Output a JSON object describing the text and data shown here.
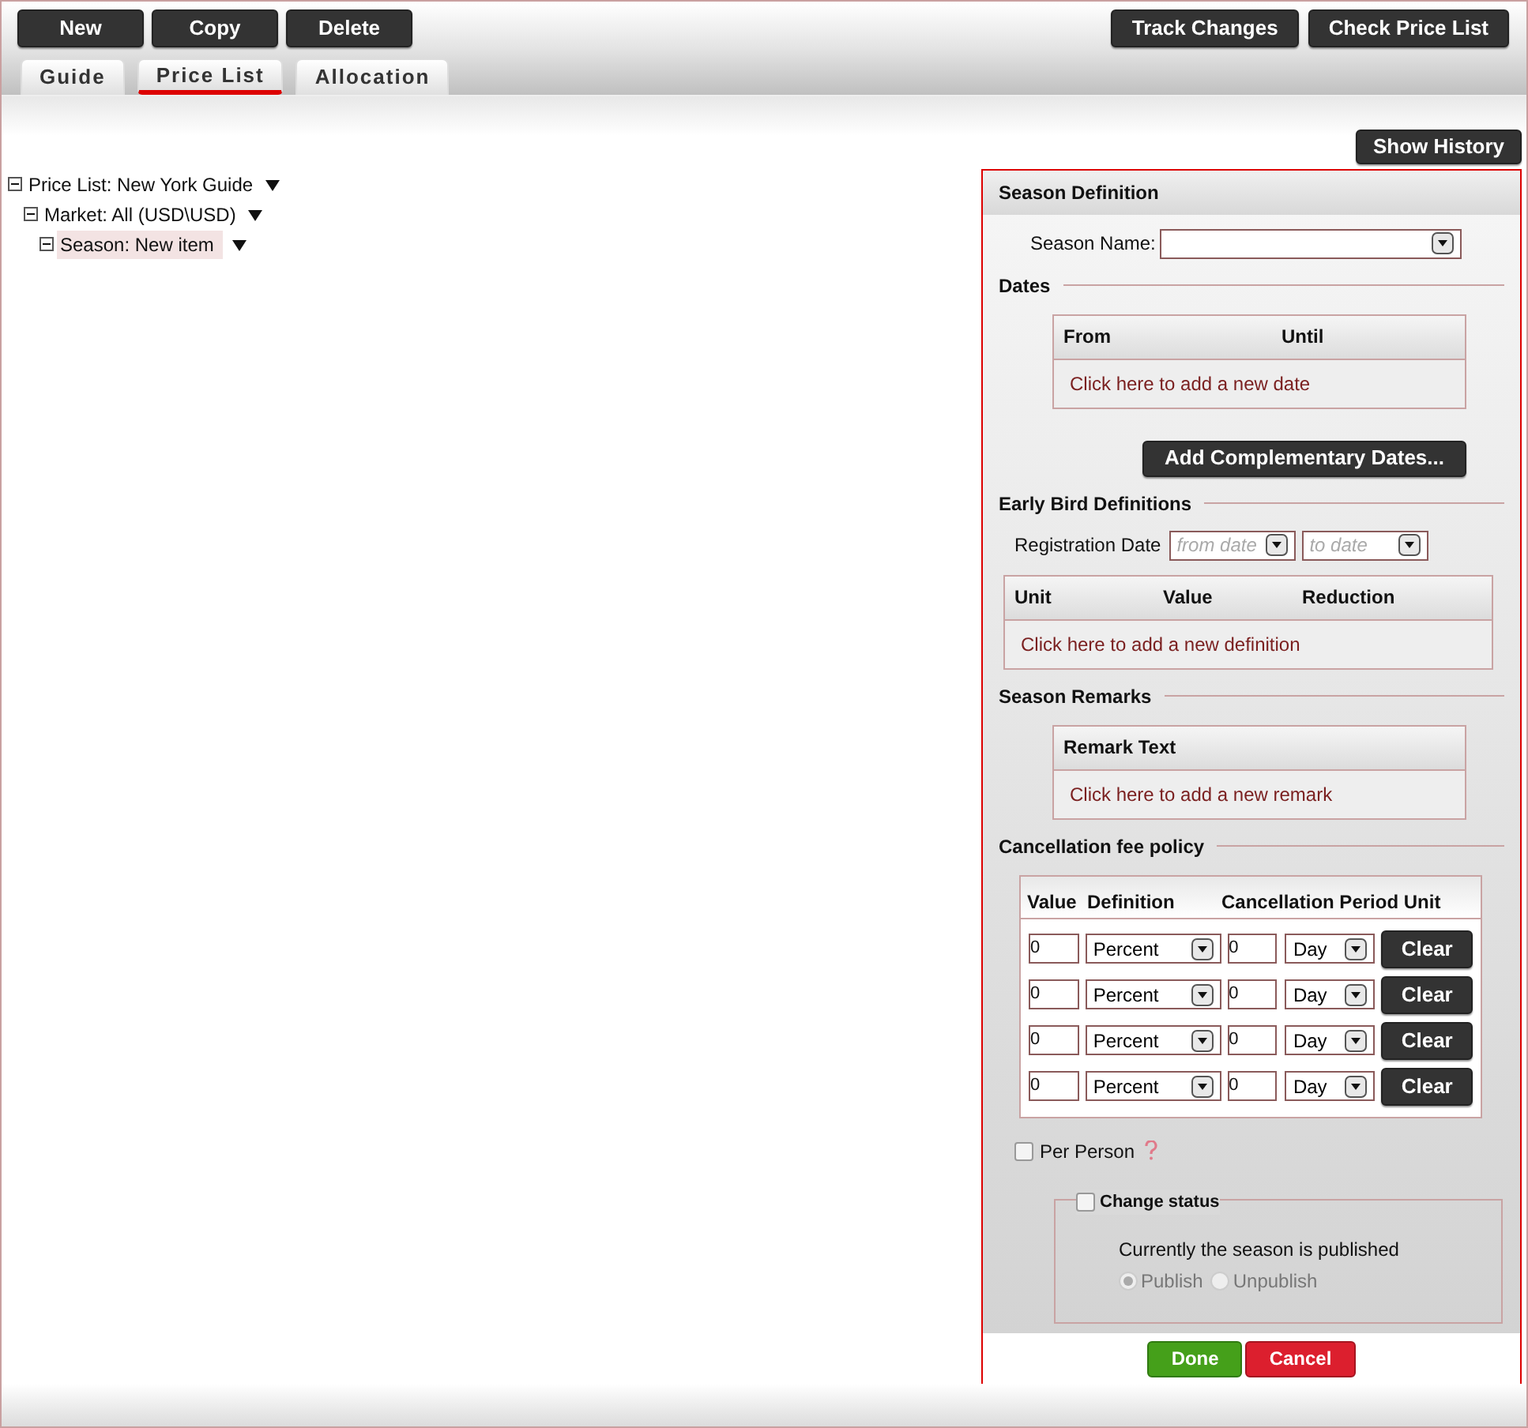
{
  "toolbar": {
    "left_buttons": [
      "New",
      "Copy",
      "Delete"
    ],
    "right_buttons": [
      "Track Changes",
      "Check Price List"
    ]
  },
  "tabs": [
    {
      "label": "Guide",
      "selected": false
    },
    {
      "label": "Price List",
      "selected": true
    },
    {
      "label": "Allocation",
      "selected": false
    }
  ],
  "show_history": "Show History",
  "tree": {
    "label": "Price List: New York Guide",
    "expanded": true,
    "selected": false,
    "children": [
      {
        "label": "Market: All (USD\\USD)",
        "expanded": true,
        "selected": false,
        "children": [
          {
            "label": "Season: New item",
            "expanded": true,
            "selected": true
          }
        ]
      }
    ]
  },
  "panel": {
    "title": "Season Definition",
    "season_name": {
      "label": "Season Name:"
    },
    "dates": {
      "title": "Dates",
      "columns": [
        "From",
        "Until"
      ],
      "add_link": "Click here to add a new date"
    },
    "complementary_button": "Add Complementary Dates...",
    "early_bird": {
      "title": "Early Bird Definitions",
      "registration_label": "Registration Date",
      "from_placeholder": "from date",
      "to_placeholder": "to date",
      "columns": [
        "Unit",
        "Value",
        "Reduction"
      ],
      "add_link": "Click here to add a new definition"
    },
    "remarks": {
      "title": "Season Remarks",
      "columns": [
        "Remark Text"
      ],
      "add_link": "Click here to add a new remark"
    },
    "cancellation": {
      "title": "Cancellation fee policy",
      "columns": [
        "Value",
        "Definition",
        "Cancellation Period Unit"
      ],
      "rows": [
        {
          "value": "0",
          "definition": "Percent",
          "period": "0",
          "unit": "Day",
          "clear": "Clear"
        },
        {
          "value": "0",
          "definition": "Percent",
          "period": "0",
          "unit": "Day",
          "clear": "Clear"
        },
        {
          "value": "0",
          "definition": "Percent",
          "period": "0",
          "unit": "Day",
          "clear": "Clear"
        },
        {
          "value": "0",
          "definition": "Percent",
          "period": "0",
          "unit": "Day",
          "clear": "Clear"
        }
      ]
    },
    "per_person": {
      "label": "Per Person",
      "checked": false
    },
    "change_status": {
      "label": "Change status",
      "checked": false,
      "message": "Currently the season is published",
      "disabled": true,
      "options": [
        {
          "label": "Publish",
          "selected": true
        },
        {
          "label": "Unpublish",
          "selected": false
        }
      ]
    },
    "footer_buttons": [
      {
        "label": "Done",
        "kind": "confirm"
      },
      {
        "label": "Cancel",
        "kind": "cancel"
      }
    ]
  }
}
